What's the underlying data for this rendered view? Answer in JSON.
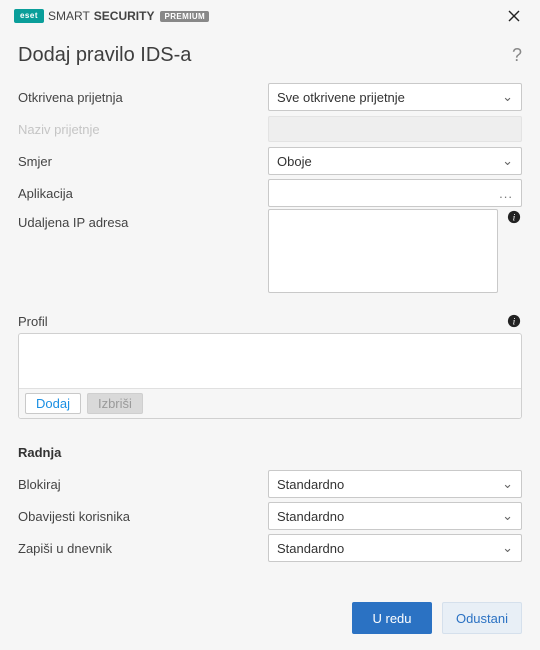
{
  "brand": {
    "logo_text": "eset",
    "name_thin": "SMART",
    "name_bold": "SECURITY",
    "badge": "PREMIUM"
  },
  "header": {
    "title": "Dodaj pravilo IDS-a"
  },
  "fields": {
    "otkrivena": {
      "label": "Otkrivena prijetnja",
      "value": "Sve otkrivene prijetnje"
    },
    "naziv": {
      "label": "Naziv prijetnje"
    },
    "smjer": {
      "label": "Smjer",
      "value": "Oboje"
    },
    "aplikacija": {
      "label": "Aplikacija"
    },
    "udaljena": {
      "label": "Udaljena IP adresa"
    }
  },
  "profil": {
    "label": "Profil",
    "add_label": "Dodaj",
    "del_label": "Izbriši"
  },
  "radnja": {
    "section": "Radnja",
    "blokiraj": {
      "label": "Blokiraj",
      "value": "Standardno"
    },
    "obavijesti": {
      "label": "Obavijesti korisnika",
      "value": "Standardno"
    },
    "zapisi": {
      "label": "Zapiši u dnevnik",
      "value": "Standardno"
    }
  },
  "footer": {
    "ok": "U redu",
    "cancel": "Odustani"
  }
}
